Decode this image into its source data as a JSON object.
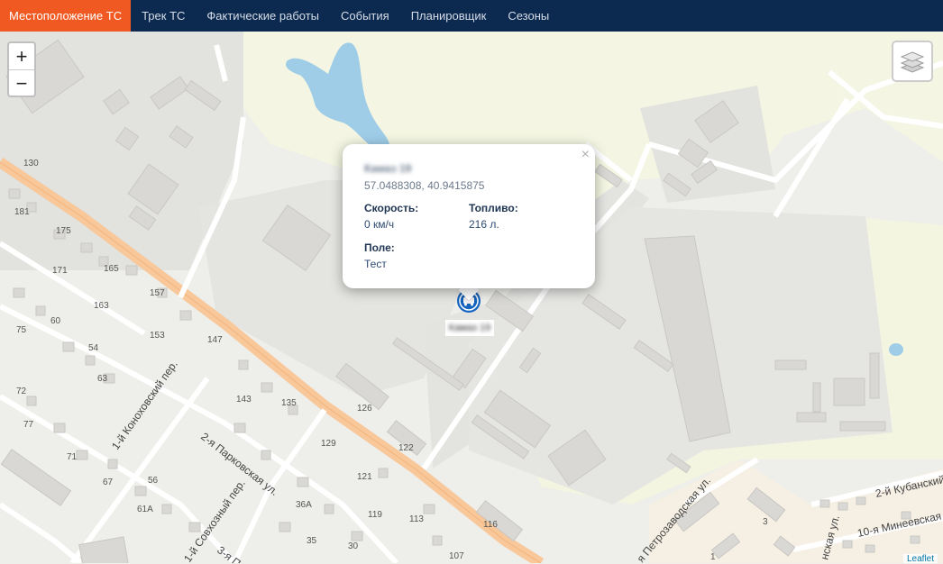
{
  "nav": {
    "tabs": [
      {
        "label": "Местоположение ТС",
        "active": true
      },
      {
        "label": "Трек ТС"
      },
      {
        "label": "Фактические работы"
      },
      {
        "label": "События"
      },
      {
        "label": "Планировщик"
      },
      {
        "label": "Сезоны"
      }
    ],
    "accent_color": "#f05a22",
    "bar_color": "#0c2a4f"
  },
  "map": {
    "zoom_in": "+",
    "zoom_out": "−",
    "layers_icon": "layers-icon",
    "attribution": "Leaflet",
    "house_numbers": [
      "130",
      "181",
      "175",
      "171",
      "165",
      "163",
      "157",
      "153",
      "147",
      "60",
      "75",
      "54",
      "63",
      "72",
      "77",
      "71",
      "67",
      "56",
      "61А",
      "143",
      "135",
      "126",
      "122",
      "129",
      "121",
      "119",
      "113",
      "107",
      "36А",
      "35",
      "30",
      "116",
      "3",
      "1"
    ],
    "street_names": [
      "1-й Коноховский пер.",
      "2-я Парковская ул.",
      "1-й Совхозный пер.",
      "3-я П",
      "я Петрозаводская ул.",
      "2-й Кубанский",
      "10-я Минеевская",
      "нская ул."
    ]
  },
  "popup": {
    "title": "Камаз 19",
    "coords": "57.0488308, 40.9415875",
    "speed_label": "Скорость:",
    "speed_value": "0 км/ч",
    "fuel_label": "Топливо:",
    "fuel_value": "216 л.",
    "field_label": "Поле:",
    "field_value": "Тест",
    "close": "×"
  },
  "marker": {
    "label": "Камаз 19",
    "icon": "truck-icon",
    "color": "#1565c0"
  }
}
